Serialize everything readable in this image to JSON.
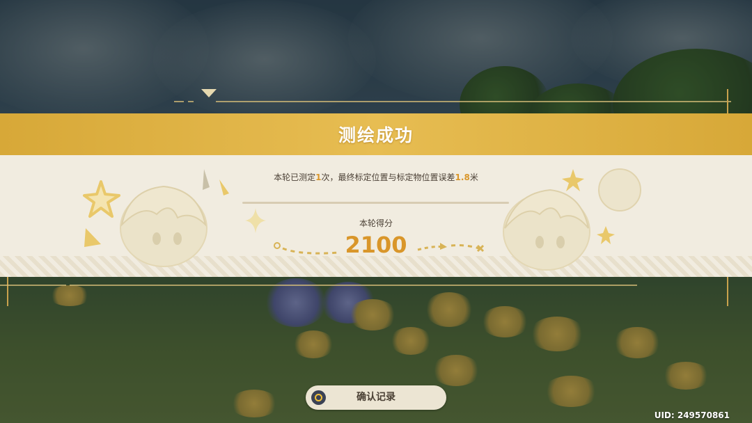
{
  "panel": {
    "title": "测绘成功",
    "summary": {
      "prefix": "本轮已测定",
      "count": "1",
      "middle": "次，最终标定位置与标定物位置误差",
      "error": "1.8",
      "suffix": "米"
    },
    "score_label": "本轮得分",
    "score": "2100"
  },
  "confirm_button": {
    "label": "确认记录",
    "icon": "circle-button-icon"
  },
  "footer": {
    "uid": "UID: 249570861"
  },
  "colors": {
    "banner": "#e2b448",
    "accent": "#d9962a",
    "panel_bg": "#f1ece0",
    "frame_line": "#c9a24d"
  }
}
